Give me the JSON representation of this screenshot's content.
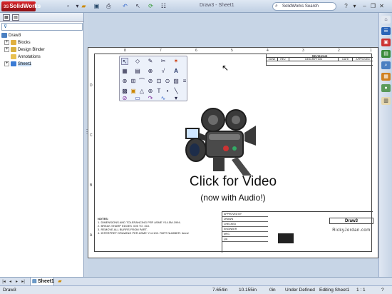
{
  "app": {
    "brand": "SolidWorks",
    "window_title": "Draw3 - Sheet1",
    "search_placeholder": "SolidWorks Search"
  },
  "toolbar": {
    "icons": [
      "new-icon",
      "open-icon",
      "save-icon",
      "print-icon",
      "undo-icon",
      "select-icon",
      "rebuild-icon",
      "options-icon"
    ]
  },
  "tree": {
    "items": [
      {
        "label": "Draw3",
        "level": 0,
        "icon": "drawing-icon"
      },
      {
        "label": "Blocks",
        "level": 1,
        "icon": "folder-icon"
      },
      {
        "label": "Design Binder",
        "level": 1,
        "icon": "binder-icon"
      },
      {
        "label": "Annotations",
        "level": 1,
        "icon": "annotations-icon"
      },
      {
        "label": "Sheet1",
        "level": 1,
        "icon": "sheet-icon",
        "selected": true
      }
    ]
  },
  "drawing": {
    "rev_header": "REVISIONS",
    "rev_cols": [
      "ZONE",
      "REV.",
      "DESCRIPTION",
      "DATE",
      "APPROVED"
    ],
    "notes_title": "NOTES:",
    "notes": [
      "1.  DIMENSIONS AND TOLERANCING PER ASME Y14.5M-1994.",
      "2.  BREAK SHARP EDGES .005 TO .010.",
      "3.  REMOVE ALL BURRS FROM PART.",
      "4.  INTERPRET DRAWING PER ASME Y14.100. PART NUMBER: item#"
    ],
    "title_block_labels": [
      "APPROVED BY",
      "DRAWN",
      "CHECKED",
      "ENGINEER",
      "MFG.",
      "QA"
    ],
    "title_name": "Draw3",
    "website": "RickyJordan.com",
    "zones_top": [
      "8",
      "7",
      "6",
      "5",
      "4",
      "3",
      "2",
      "1"
    ],
    "zones_side": [
      "D",
      "C",
      "B",
      "A"
    ]
  },
  "overlay": {
    "title": "Click for Video",
    "subtitle": "(now with Audio!)"
  },
  "sheet_tab": {
    "label": "Sheet1"
  },
  "status": {
    "name": "Draw3",
    "x": "7.654in",
    "y": "10.155in",
    "z": "0in",
    "state": "Under Defined",
    "editing": "Editing Sheet1",
    "scale": "1 : 1"
  }
}
